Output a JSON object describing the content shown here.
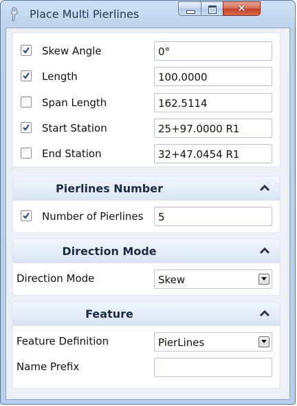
{
  "window": {
    "title": "Place Multi Pierlines"
  },
  "icons": {
    "app": "pin-tool-icon",
    "minimize": "minimize-icon",
    "maximize": "maximize-icon",
    "close": "close-icon",
    "collapse": "chevron-up-icon",
    "dropdown": "chevron-down-icon"
  },
  "params": [
    {
      "label": "Skew Angle",
      "checked": true,
      "value": "0°"
    },
    {
      "label": "Length",
      "checked": true,
      "value": "100.0000"
    },
    {
      "label": "Span Length",
      "checked": false,
      "value": "162.5114"
    },
    {
      "label": "Start Station",
      "checked": true,
      "value": "25+97.0000 R1"
    },
    {
      "label": "End Station",
      "checked": false,
      "value": "32+47.0454 R1"
    }
  ],
  "pierlines_number": {
    "title": "Pierlines Number",
    "number_label": "Number of Pierlines",
    "number_checked": true,
    "number_value": "5"
  },
  "direction_mode": {
    "title": "Direction Mode",
    "label": "Direction Mode",
    "value": "Skew"
  },
  "feature": {
    "title": "Feature",
    "definition_label": "Feature Definition",
    "definition_value": "PierLines",
    "prefix_label": "Name Prefix",
    "prefix_value": ""
  },
  "colors": {
    "checkmark": "#2b4a7a",
    "title_text": "#1e3957",
    "close_button": "#c0432a"
  }
}
